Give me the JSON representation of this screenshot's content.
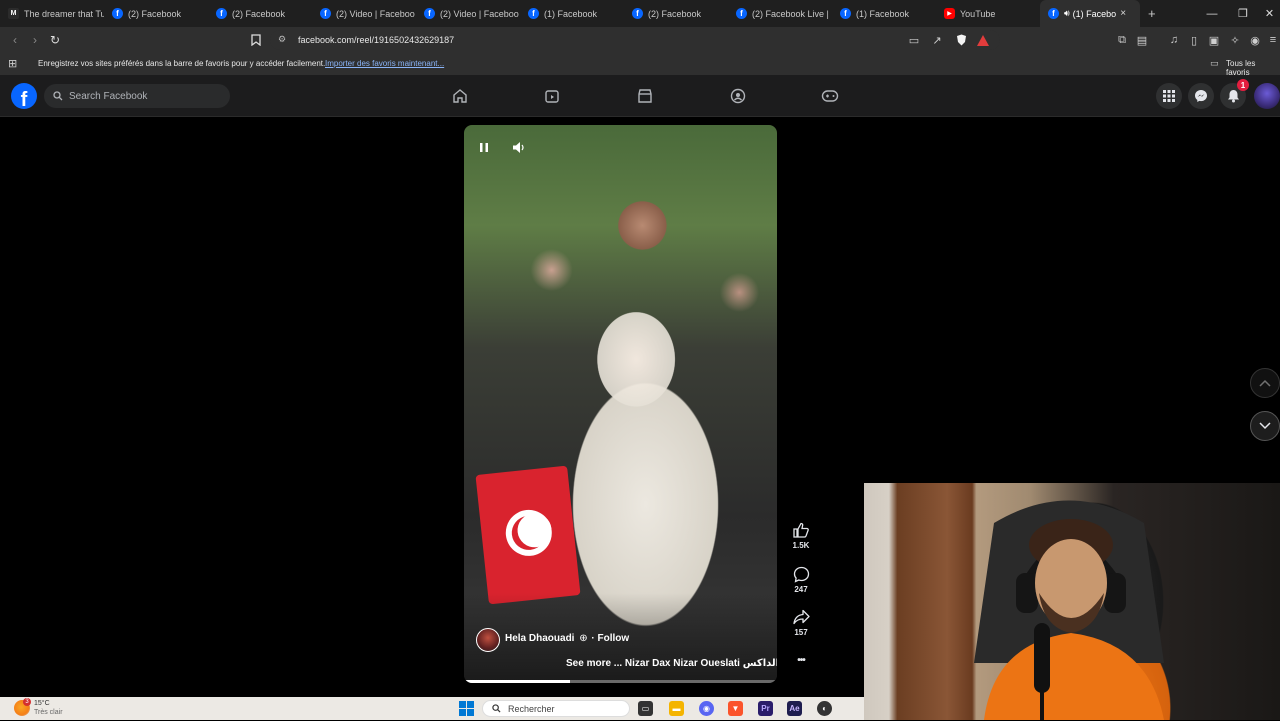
{
  "browser": {
    "tabs": [
      {
        "title": "The dreamer that Tu",
        "icon": "medium-icon",
        "color": "#2b2b2b"
      },
      {
        "title": "(2) Facebook",
        "icon": "facebook-icon",
        "color": "#0866ff"
      },
      {
        "title": "(2) Facebook",
        "icon": "facebook-icon",
        "color": "#0866ff"
      },
      {
        "title": "(2) Video | Faceboo",
        "icon": "facebook-icon",
        "color": "#0866ff"
      },
      {
        "title": "(2) Video | Faceboo",
        "icon": "facebook-icon",
        "color": "#0866ff"
      },
      {
        "title": "(1) Facebook",
        "icon": "facebook-icon",
        "color": "#0866ff"
      },
      {
        "title": "(2) Facebook",
        "icon": "facebook-icon",
        "color": "#0866ff"
      },
      {
        "title": "(2) Facebook Live |",
        "icon": "facebook-icon",
        "color": "#0866ff"
      },
      {
        "title": "(1) Facebook",
        "icon": "facebook-icon",
        "color": "#0866ff"
      },
      {
        "title": "YouTube",
        "icon": "youtube-icon",
        "color": "#ff0000"
      }
    ],
    "active_tab": {
      "title": "(1) Facebo",
      "close": "×"
    },
    "new_tab": "+",
    "url": "facebook.com/reel/1916502432629187",
    "bookmarks_bar": {
      "message": "Enregistrez vos sites préférés dans la barre de favoris pour y accéder facilement.",
      "import_link": "Importer des favoris maintenant...",
      "all_bookmarks": "Tous les favoris"
    }
  },
  "facebook": {
    "search_placeholder": "Search Facebook",
    "notification_count": "1",
    "brand_color": "#0866ff"
  },
  "reel": {
    "author": "Hela Dhaouadi",
    "follow_label": "· Follow",
    "caption": "See more ... Nizar Dax Nizar Oueslati الداكس",
    "likes": "1.5K",
    "comments": "247",
    "shares": "157",
    "more": "•••",
    "progress": 0.34
  },
  "taskbar": {
    "weather_temp": "15°C",
    "weather_desc": "Très clair",
    "search_placeholder": "Rechercher"
  }
}
